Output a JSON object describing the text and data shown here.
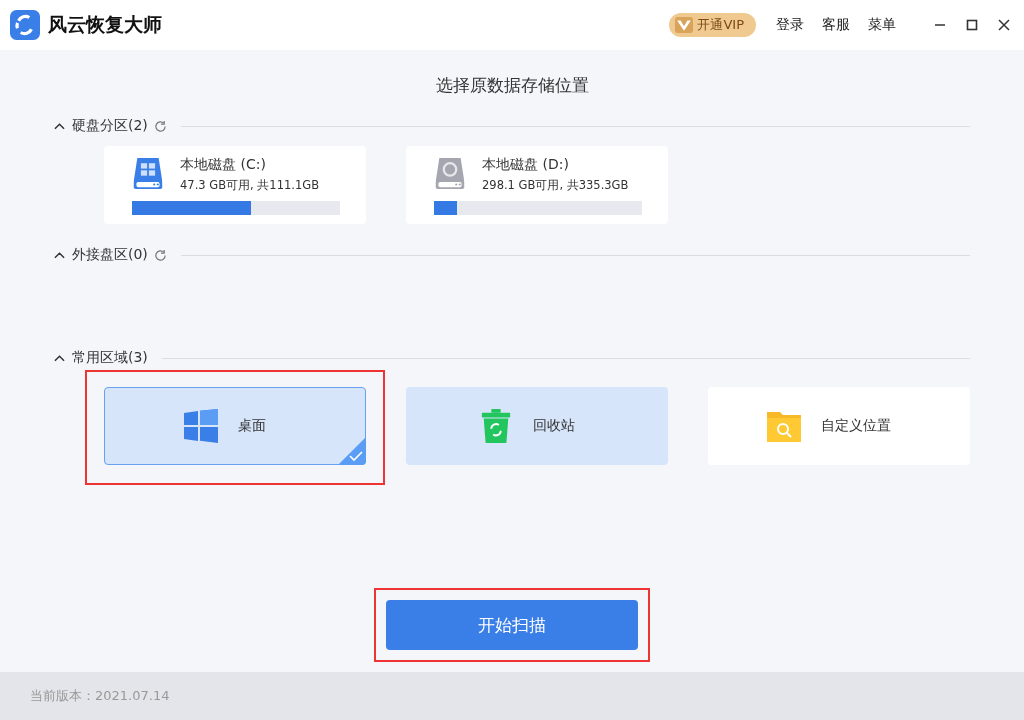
{
  "window": {
    "title": "风云恢复大师",
    "vip_label": "开通VIP",
    "menu": [
      "登录",
      "客服",
      "菜单"
    ]
  },
  "heading": "选择原数据存储位置",
  "sections": [
    {
      "title": "硬盘分区(2)",
      "expanded": true,
      "refreshable": true,
      "kind": "disks",
      "items": [
        {
          "name": "本地磁盘 (C:)",
          "detail": "47.3 GB可用, 共111.1GB",
          "level": 0.57,
          "kind": "system"
        },
        {
          "name": "本地磁盘 (D:)",
          "detail": "298.1 GB可用, 共335.3GB",
          "level": 0.11,
          "kind": "data"
        }
      ]
    },
    {
      "title": "外接盘区(0)",
      "expanded": true,
      "refreshable": true,
      "kind": "disks"
    },
    {
      "title": "常用区域(3)",
      "expanded": true,
      "kind": "places",
      "items": [
        {
          "name": "桌面",
          "kind": "desktop",
          "selected": true,
          "hovered": false,
          "annotated": true
        },
        {
          "name": "回收站",
          "kind": "recycle",
          "selected": false,
          "hovered": true,
          "annotated": false
        },
        {
          "name": "自定义位置",
          "kind": "folder",
          "selected": false,
          "hovered": false,
          "annotated": false
        }
      ]
    }
  ],
  "scan_button": {
    "label": "开始扫描",
    "annotated": true
  },
  "status_bar": "当前版本：2021.07.14"
}
